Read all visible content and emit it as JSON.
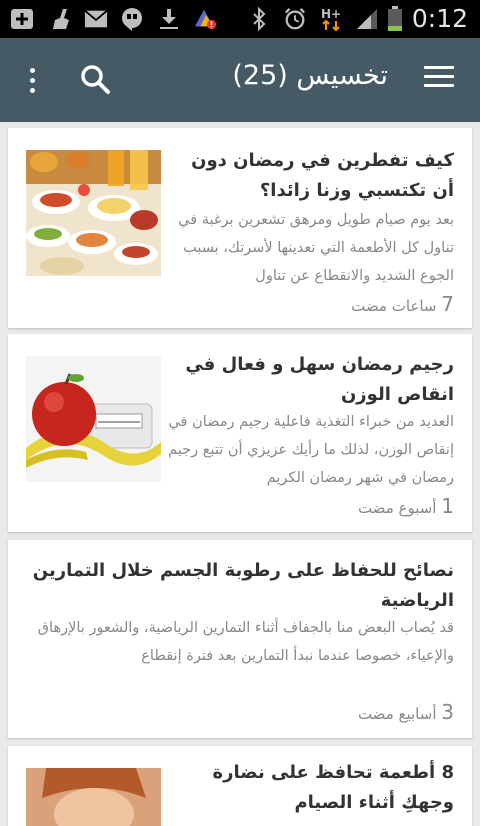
{
  "status_bar": {
    "time": "0:12",
    "left_icons": [
      "add-box-icon",
      "cleaner-icon",
      "mail-icon",
      "hangouts-icon",
      "download-icon",
      "update-alert-icon"
    ],
    "right_icons": [
      "bluetooth-icon",
      "alarm-icon",
      "hplus-data-icon",
      "signal-icon",
      "battery-icon"
    ]
  },
  "app_bar": {
    "title": "تخسيس (25)",
    "color": "#455a64"
  },
  "articles": [
    {
      "title": "كيف تفطرين في رمضان دون أن تكتسبي وزنا زائدا؟",
      "excerpt": "بعد يوم صيام طويل ومرهق تشعرين برغبة في تناول كل الأطعمة التي تعدينها لأسرتك، بسبب الجوع الشديد والانقطاع عن تناول",
      "time_num": "7",
      "time_unit": "ساعات مضت",
      "image": "breakfast-food-image"
    },
    {
      "title": "رجيم رمضان سهل و فعال في انقاص الوزن",
      "excerpt": "العديد من خبراء التغذية فاعلية رجيم رمضان في إنقاص الوزن، لذلك ما رأيك عزيزي أن تتبع رجيم رمضان في شهر رمضان الكريم",
      "time_num": "1",
      "time_unit": "أسبوع مضت",
      "image": "apple-scale-image"
    },
    {
      "title": "نصائح للحفاظ على رطوبة الجسم خلال التمارين الرياضية",
      "excerpt": "قد يُصاب البعض منا بالجفاف أثناء التمارين الرياضية، والشعور بالإرهاق والإعياء، خصوصا عندما نبدأ التمارين بعد فترة إنقطاع",
      "time_num": "3",
      "time_unit": "أسابيع مضت",
      "image": ""
    },
    {
      "title": "8 أطعمة تحافظ على نضارة وجهكِ أثناء الصيام",
      "excerpt": "",
      "time_num": "",
      "time_unit": "",
      "image": "woman-face-image"
    }
  ]
}
